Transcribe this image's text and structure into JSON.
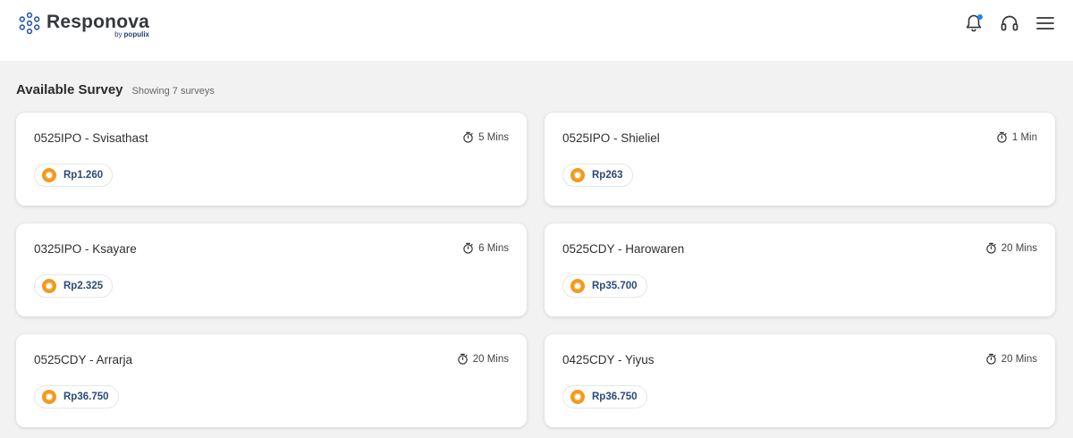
{
  "brand": {
    "name": "Responova",
    "by": "by",
    "parent": "populix"
  },
  "section": {
    "title": "Available Survey",
    "count_text": "Showing 7 surveys"
  },
  "surveys": [
    {
      "title": "0525IPO - Svisathast",
      "duration": "5 Mins",
      "reward": "Rp1.260"
    },
    {
      "title": "0525IPO - Shieliel",
      "duration": "1 Min",
      "reward": "Rp263"
    },
    {
      "title": "0325IPO - Ksayare",
      "duration": "6 Mins",
      "reward": "Rp2.325"
    },
    {
      "title": "0525CDY - Harowaren",
      "duration": "20 Mins",
      "reward": "Rp35.700"
    },
    {
      "title": "0525CDY - Arrarja",
      "duration": "20 Mins",
      "reward": "Rp36.750"
    },
    {
      "title": "0425CDY - Yiyus",
      "duration": "20 Mins",
      "reward": "Rp36.750"
    }
  ],
  "colors": {
    "accent": "#1e88e5",
    "coin": "#f29a1e",
    "reward_text": "#2d4a78"
  },
  "icons": {
    "notification": "bell-icon",
    "support": "headset-icon",
    "menu": "hamburger-menu-icon",
    "duration": "stopwatch-icon",
    "reward": "coin-icon"
  }
}
